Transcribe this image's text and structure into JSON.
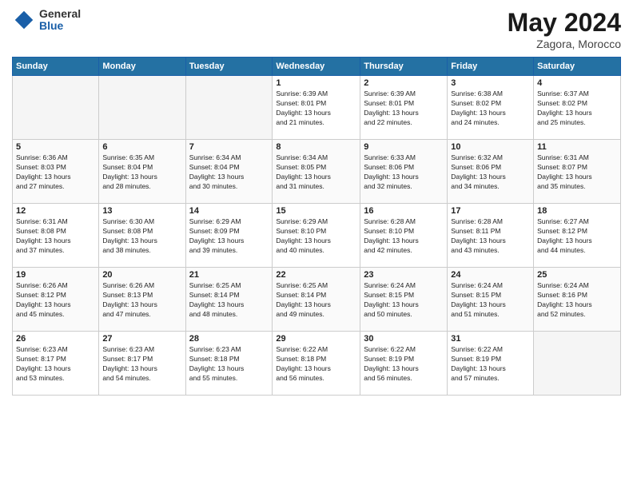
{
  "header": {
    "logo": {
      "general": "General",
      "blue": "Blue"
    },
    "title": "May 2024",
    "subtitle": "Zagora, Morocco"
  },
  "weekdays": [
    "Sunday",
    "Monday",
    "Tuesday",
    "Wednesday",
    "Thursday",
    "Friday",
    "Saturday"
  ],
  "weeks": [
    [
      {
        "day": "",
        "info": ""
      },
      {
        "day": "",
        "info": ""
      },
      {
        "day": "",
        "info": ""
      },
      {
        "day": "1",
        "info": "Sunrise: 6:39 AM\nSunset: 8:01 PM\nDaylight: 13 hours\nand 21 minutes."
      },
      {
        "day": "2",
        "info": "Sunrise: 6:39 AM\nSunset: 8:01 PM\nDaylight: 13 hours\nand 22 minutes."
      },
      {
        "day": "3",
        "info": "Sunrise: 6:38 AM\nSunset: 8:02 PM\nDaylight: 13 hours\nand 24 minutes."
      },
      {
        "day": "4",
        "info": "Sunrise: 6:37 AM\nSunset: 8:02 PM\nDaylight: 13 hours\nand 25 minutes."
      }
    ],
    [
      {
        "day": "5",
        "info": "Sunrise: 6:36 AM\nSunset: 8:03 PM\nDaylight: 13 hours\nand 27 minutes."
      },
      {
        "day": "6",
        "info": "Sunrise: 6:35 AM\nSunset: 8:04 PM\nDaylight: 13 hours\nand 28 minutes."
      },
      {
        "day": "7",
        "info": "Sunrise: 6:34 AM\nSunset: 8:04 PM\nDaylight: 13 hours\nand 30 minutes."
      },
      {
        "day": "8",
        "info": "Sunrise: 6:34 AM\nSunset: 8:05 PM\nDaylight: 13 hours\nand 31 minutes."
      },
      {
        "day": "9",
        "info": "Sunrise: 6:33 AM\nSunset: 8:06 PM\nDaylight: 13 hours\nand 32 minutes."
      },
      {
        "day": "10",
        "info": "Sunrise: 6:32 AM\nSunset: 8:06 PM\nDaylight: 13 hours\nand 34 minutes."
      },
      {
        "day": "11",
        "info": "Sunrise: 6:31 AM\nSunset: 8:07 PM\nDaylight: 13 hours\nand 35 minutes."
      }
    ],
    [
      {
        "day": "12",
        "info": "Sunrise: 6:31 AM\nSunset: 8:08 PM\nDaylight: 13 hours\nand 37 minutes."
      },
      {
        "day": "13",
        "info": "Sunrise: 6:30 AM\nSunset: 8:08 PM\nDaylight: 13 hours\nand 38 minutes."
      },
      {
        "day": "14",
        "info": "Sunrise: 6:29 AM\nSunset: 8:09 PM\nDaylight: 13 hours\nand 39 minutes."
      },
      {
        "day": "15",
        "info": "Sunrise: 6:29 AM\nSunset: 8:10 PM\nDaylight: 13 hours\nand 40 minutes."
      },
      {
        "day": "16",
        "info": "Sunrise: 6:28 AM\nSunset: 8:10 PM\nDaylight: 13 hours\nand 42 minutes."
      },
      {
        "day": "17",
        "info": "Sunrise: 6:28 AM\nSunset: 8:11 PM\nDaylight: 13 hours\nand 43 minutes."
      },
      {
        "day": "18",
        "info": "Sunrise: 6:27 AM\nSunset: 8:12 PM\nDaylight: 13 hours\nand 44 minutes."
      }
    ],
    [
      {
        "day": "19",
        "info": "Sunrise: 6:26 AM\nSunset: 8:12 PM\nDaylight: 13 hours\nand 45 minutes."
      },
      {
        "day": "20",
        "info": "Sunrise: 6:26 AM\nSunset: 8:13 PM\nDaylight: 13 hours\nand 47 minutes."
      },
      {
        "day": "21",
        "info": "Sunrise: 6:25 AM\nSunset: 8:14 PM\nDaylight: 13 hours\nand 48 minutes."
      },
      {
        "day": "22",
        "info": "Sunrise: 6:25 AM\nSunset: 8:14 PM\nDaylight: 13 hours\nand 49 minutes."
      },
      {
        "day": "23",
        "info": "Sunrise: 6:24 AM\nSunset: 8:15 PM\nDaylight: 13 hours\nand 50 minutes."
      },
      {
        "day": "24",
        "info": "Sunrise: 6:24 AM\nSunset: 8:15 PM\nDaylight: 13 hours\nand 51 minutes."
      },
      {
        "day": "25",
        "info": "Sunrise: 6:24 AM\nSunset: 8:16 PM\nDaylight: 13 hours\nand 52 minutes."
      }
    ],
    [
      {
        "day": "26",
        "info": "Sunrise: 6:23 AM\nSunset: 8:17 PM\nDaylight: 13 hours\nand 53 minutes."
      },
      {
        "day": "27",
        "info": "Sunrise: 6:23 AM\nSunset: 8:17 PM\nDaylight: 13 hours\nand 54 minutes."
      },
      {
        "day": "28",
        "info": "Sunrise: 6:23 AM\nSunset: 8:18 PM\nDaylight: 13 hours\nand 55 minutes."
      },
      {
        "day": "29",
        "info": "Sunrise: 6:22 AM\nSunset: 8:18 PM\nDaylight: 13 hours\nand 56 minutes."
      },
      {
        "day": "30",
        "info": "Sunrise: 6:22 AM\nSunset: 8:19 PM\nDaylight: 13 hours\nand 56 minutes."
      },
      {
        "day": "31",
        "info": "Sunrise: 6:22 AM\nSunset: 8:19 PM\nDaylight: 13 hours\nand 57 minutes."
      },
      {
        "day": "",
        "info": ""
      }
    ]
  ]
}
